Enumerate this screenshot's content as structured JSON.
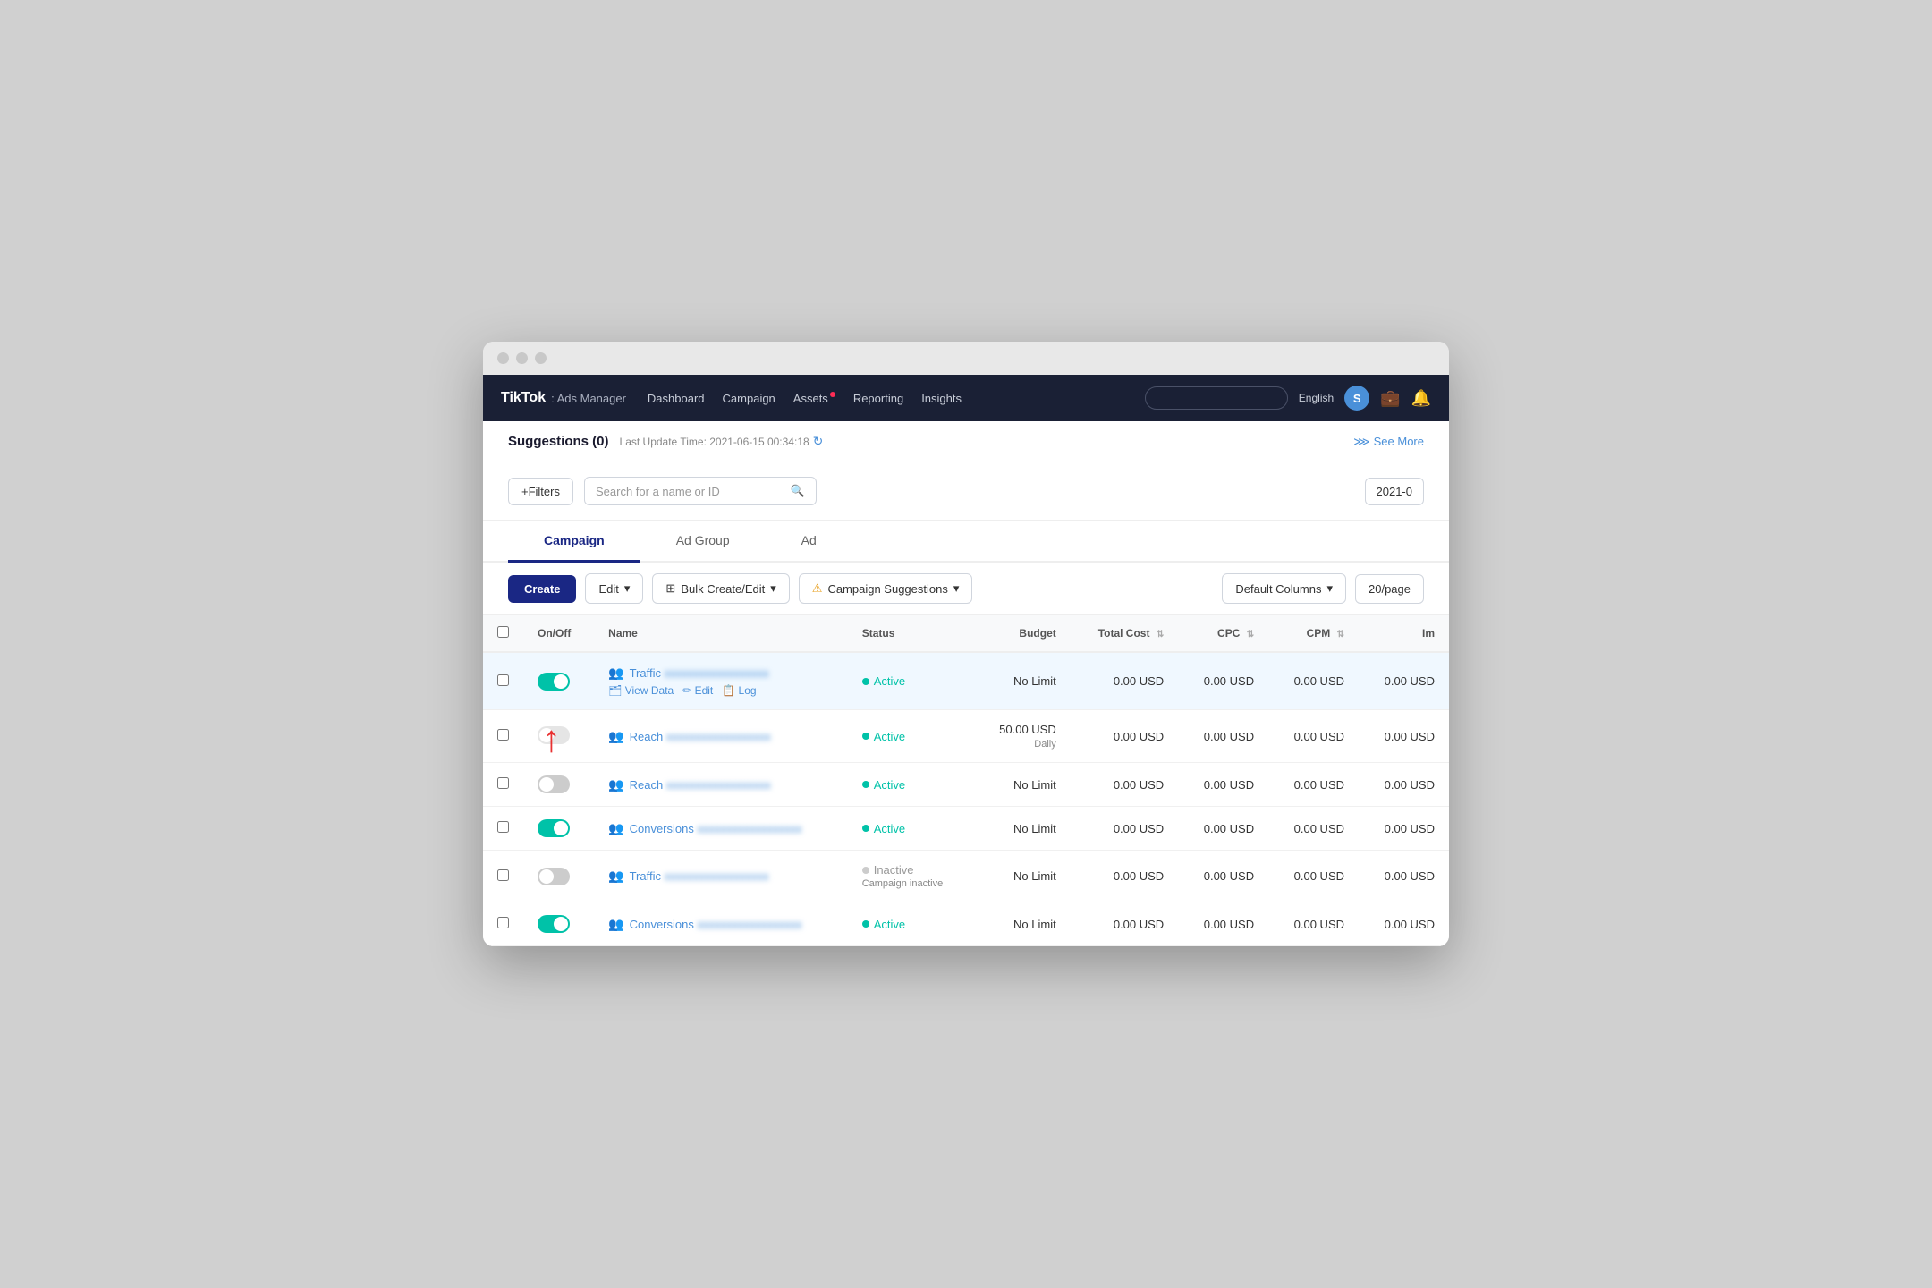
{
  "window": {
    "title": "TikTok Ads Manager"
  },
  "navbar": {
    "brand": "TikTok",
    "brand_sub": ": Ads Manager",
    "nav_items": [
      {
        "label": "Dashboard",
        "active": false
      },
      {
        "label": "Campaign",
        "active": false
      },
      {
        "label": "Assets",
        "active": false,
        "badge": true
      },
      {
        "label": "Reporting",
        "active": false
      },
      {
        "label": "Insights",
        "active": false
      }
    ],
    "search_placeholder": "",
    "lang": "English",
    "avatar_initial": "S"
  },
  "suggestions": {
    "title": "Suggestions (0)",
    "update_label": "Last Update Time: 2021-06-15 00:34:18",
    "see_more": "See More"
  },
  "toolbar": {
    "filters_label": "+Filters",
    "search_placeholder": "Search for a name or ID",
    "date_value": "2021-0"
  },
  "tabs": [
    {
      "label": "Campaign",
      "active": true
    },
    {
      "label": "Ad Group",
      "active": false
    },
    {
      "label": "Ad",
      "active": false
    }
  ],
  "action_bar": {
    "create_label": "Create",
    "edit_label": "Edit",
    "bulk_create_label": "Bulk Create/Edit",
    "campaign_suggestions_label": "Campaign Suggestions",
    "default_columns_label": "Default Columns",
    "per_page_label": "20/page"
  },
  "table": {
    "headers": [
      {
        "label": "",
        "type": "checkbox"
      },
      {
        "label": "On/Off",
        "type": "toggle"
      },
      {
        "label": "Name"
      },
      {
        "label": "Status"
      },
      {
        "label": "Budget",
        "align": "right"
      },
      {
        "label": "Total Cost",
        "align": "right",
        "sortable": true
      },
      {
        "label": "CPC",
        "align": "right",
        "sortable": true
      },
      {
        "label": "CPM",
        "align": "right",
        "sortable": true
      },
      {
        "label": "Im",
        "align": "right"
      }
    ],
    "rows": [
      {
        "id": 1,
        "toggle": "on",
        "highlighted": true,
        "name": "Traffic",
        "name_blurred": "xxxxxxxxxxxxxxxxxx",
        "has_actions": true,
        "actions": [
          "View Data",
          "Edit",
          "Log"
        ],
        "status": "Active",
        "status_type": "active",
        "budget": "No Limit",
        "budget_daily": "",
        "total_cost": "0.00 USD",
        "cpc": "0.00 USD",
        "cpm": "0.00 USD",
        "im": "0.00 USD"
      },
      {
        "id": 2,
        "toggle": "off",
        "highlighted": false,
        "name": "Reach",
        "name_blurred": "xxxxxxxxxxxxxxxxxx",
        "has_actions": false,
        "actions": [],
        "status": "Active",
        "status_type": "active",
        "budget": "50.00 USD",
        "budget_daily": "Daily",
        "total_cost": "0.00 USD",
        "cpc": "0.00 USD",
        "cpm": "0.00 USD",
        "im": "0.00 USD"
      },
      {
        "id": 3,
        "toggle": "partial",
        "highlighted": false,
        "name": "Reach",
        "name_blurred": "xxxxxxxxxxxxxxxxxx",
        "has_actions": false,
        "actions": [],
        "status": "Active",
        "status_type": "active",
        "budget": "No Limit",
        "budget_daily": "",
        "total_cost": "0.00 USD",
        "cpc": "0.00 USD",
        "cpm": "0.00 USD",
        "im": "0.00 USD"
      },
      {
        "id": 4,
        "toggle": "on",
        "highlighted": false,
        "name": "Conversions",
        "name_blurred": "xxxxxxxxxxxxxxxxxx",
        "has_actions": false,
        "actions": [],
        "status": "Active",
        "status_type": "active",
        "budget": "No Limit",
        "budget_daily": "",
        "total_cost": "0.00 USD",
        "cpc": "0.00 USD",
        "cpm": "0.00 USD",
        "im": "0.00 USD"
      },
      {
        "id": 5,
        "toggle": "off",
        "highlighted": false,
        "name": "Traffic",
        "name_blurred": "xxxxxxxxxxxxxxxxxx",
        "has_actions": false,
        "actions": [],
        "status": "Inactive",
        "status_type": "inactive",
        "status_sub": "Campaign inactive",
        "budget": "No Limit",
        "budget_daily": "",
        "total_cost": "0.00 USD",
        "cpc": "0.00 USD",
        "cpm": "0.00 USD",
        "im": "0.00 USD"
      },
      {
        "id": 6,
        "toggle": "on",
        "highlighted": false,
        "name": "Conversions",
        "name_blurred": "xxxxxxxxxxxxxxxxxx",
        "has_actions": false,
        "actions": [],
        "status": "Active",
        "status_type": "active",
        "budget": "No Limit",
        "budget_daily": "",
        "total_cost": "0.00 USD",
        "cpc": "0.00 USD",
        "cpm": "0.00 USD",
        "im": "0.00 USD"
      }
    ]
  }
}
